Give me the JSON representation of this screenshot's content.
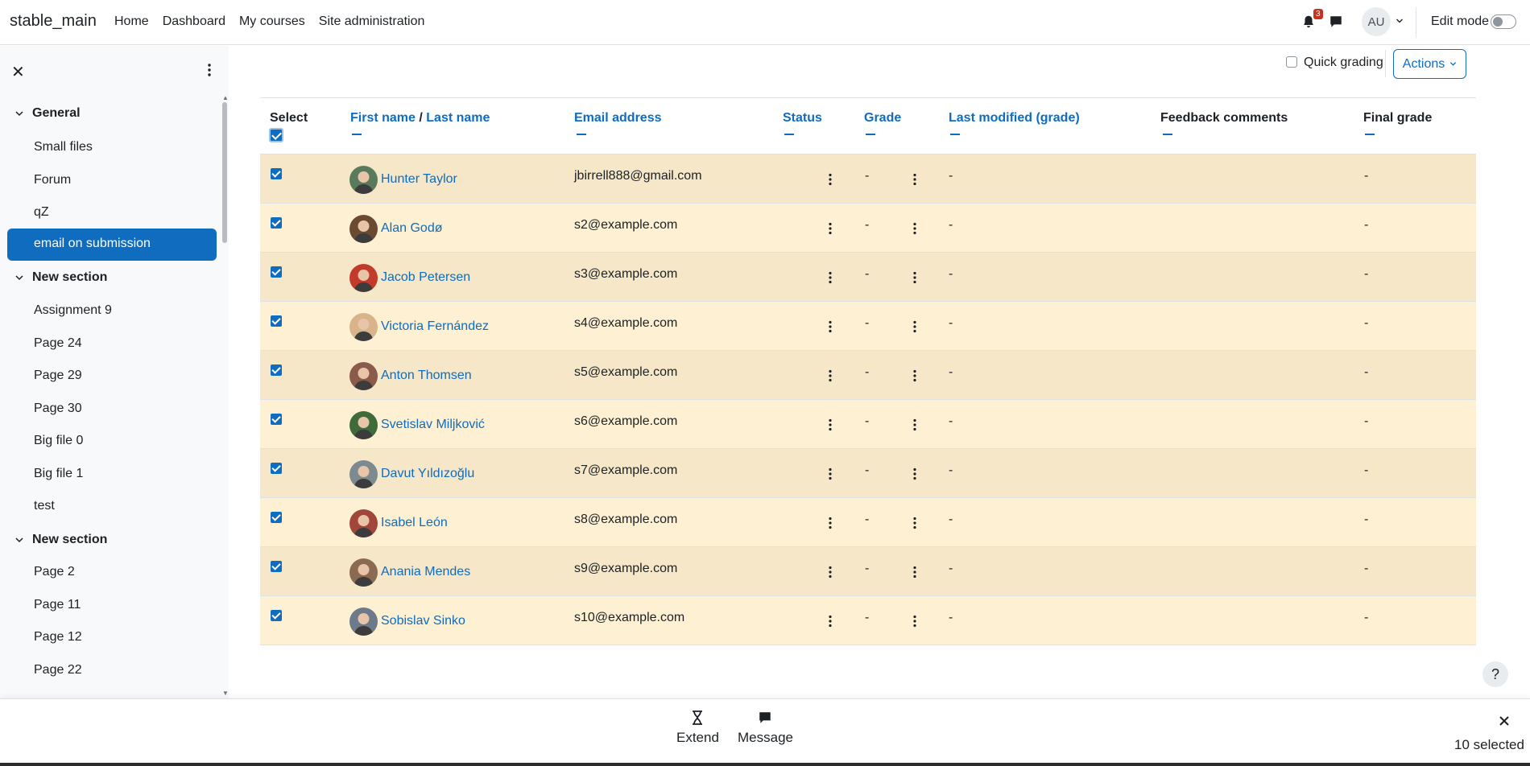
{
  "navbar": {
    "brand": "stable_main",
    "links": [
      "Home",
      "Dashboard",
      "My courses",
      "Site administration"
    ],
    "notification_count": "3",
    "user_initials": "AU",
    "edit_mode_label": "Edit mode"
  },
  "sidebar": {
    "sections": [
      {
        "title": "General",
        "items": [
          "Small files",
          "Forum",
          "qZ",
          "email on submission"
        ]
      },
      {
        "title": "New section",
        "items": [
          "Assignment 9",
          "Page 24",
          "Page 29",
          "Page 30",
          "Big file 0",
          "Big file 1",
          "test"
        ]
      },
      {
        "title": "New section",
        "items": [
          "Page 2",
          "Page 11",
          "Page 12",
          "Page 22"
        ]
      }
    ],
    "active_item": "email on submission"
  },
  "toolbar": {
    "quick_grading_label": "Quick grading",
    "actions_label": "Actions"
  },
  "table": {
    "headers": {
      "select": "Select",
      "first_name": "First name",
      "separator": "/",
      "last_name": "Last name",
      "email": "Email address",
      "status": "Status",
      "grade": "Grade",
      "last_modified": "Last modified (grade)",
      "feedback": "Feedback comments",
      "final_grade": "Final grade"
    },
    "rows": [
      {
        "name": "Hunter Taylor",
        "email": "jbirrell888@gmail.com",
        "grade": "-",
        "last_modified": "-",
        "final_grade": "-",
        "avatar_color": "#5a7a5c",
        "selected": true
      },
      {
        "name": "Alan Godø",
        "email": "s2@example.com",
        "grade": "-",
        "last_modified": "-",
        "final_grade": "-",
        "avatar_color": "#6b4a32",
        "selected": true
      },
      {
        "name": "Jacob Petersen",
        "email": "s3@example.com",
        "grade": "-",
        "last_modified": "-",
        "final_grade": "-",
        "avatar_color": "#c23a2b",
        "selected": true
      },
      {
        "name": "Victoria Fernández",
        "email": "s4@example.com",
        "grade": "-",
        "last_modified": "-",
        "final_grade": "-",
        "avatar_color": "#d9b48a",
        "selected": true
      },
      {
        "name": "Anton Thomsen",
        "email": "s5@example.com",
        "grade": "-",
        "last_modified": "-",
        "final_grade": "-",
        "avatar_color": "#8a5a4a",
        "selected": true
      },
      {
        "name": "Svetislav Miljković",
        "email": "s6@example.com",
        "grade": "-",
        "last_modified": "-",
        "final_grade": "-",
        "avatar_color": "#3f6a3a",
        "selected": true
      },
      {
        "name": "Davut Yıldızoğlu",
        "email": "s7@example.com",
        "grade": "-",
        "last_modified": "-",
        "final_grade": "-",
        "avatar_color": "#7d8a90",
        "selected": true
      },
      {
        "name": "Isabel León",
        "email": "s8@example.com",
        "grade": "-",
        "last_modified": "-",
        "final_grade": "-",
        "avatar_color": "#a0463a",
        "selected": true
      },
      {
        "name": "Anania Mendes",
        "email": "s9@example.com",
        "grade": "-",
        "last_modified": "-",
        "final_grade": "-",
        "avatar_color": "#8b6a52",
        "selected": true
      },
      {
        "name": "Sobislav Sinko",
        "email": "s10@example.com",
        "grade": "-",
        "last_modified": "-",
        "final_grade": "-",
        "avatar_color": "#6c7a8a",
        "selected": true
      }
    ]
  },
  "help_label": "?",
  "bulk_actions": {
    "extend_label": "Extend",
    "message_label": "Message",
    "selected_count": "10 selected"
  },
  "colors": {
    "primary": "#0f6cbf",
    "row_odd": "#f5e7c8",
    "row_even": "#fdf0d3",
    "badge": "#ca3120"
  }
}
